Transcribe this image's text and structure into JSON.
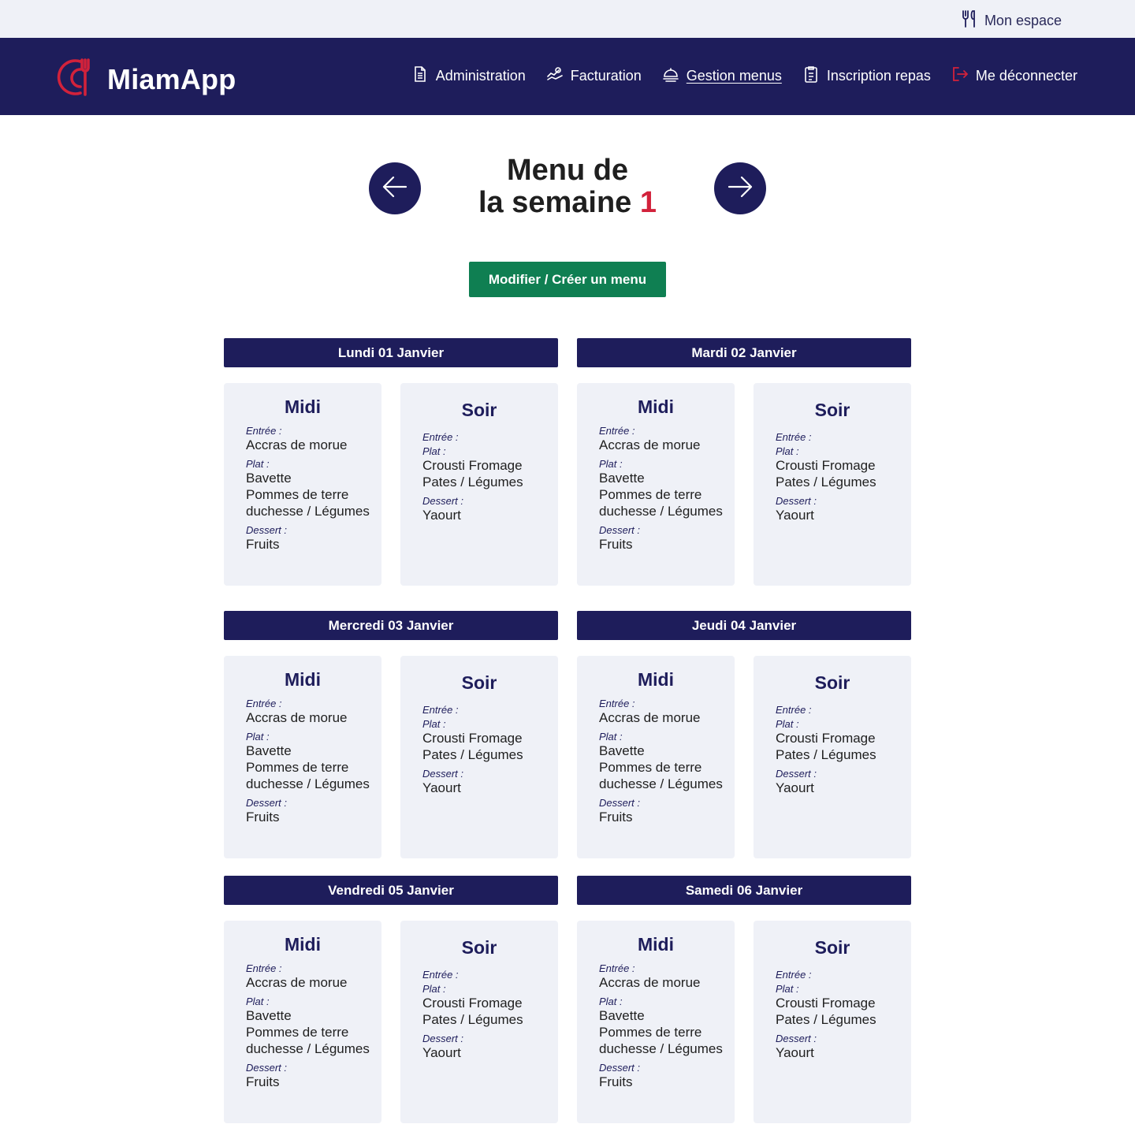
{
  "topbar": {
    "mon_espace": "Mon espace",
    "icon": "utensils-icon"
  },
  "brand": {
    "name": "MiamApp",
    "accent": "#d2223b",
    "navy": "#1e1d5b",
    "green": "#0f7f52"
  },
  "nav": [
    {
      "label": "Administration",
      "icon": "document-icon",
      "active": false
    },
    {
      "label": "Facturation",
      "icon": "payment-icon",
      "active": false
    },
    {
      "label": "Gestion menus",
      "icon": "cloche-icon",
      "active": true
    },
    {
      "label": "Inscription repas",
      "icon": "clipboard-icon",
      "active": false
    },
    {
      "label": "Me déconnecter",
      "icon": "logout-icon",
      "active": false
    }
  ],
  "week": {
    "title_line1": "Menu de",
    "title_line2": "la semaine",
    "number": "1"
  },
  "edit_button": "Modifier / Créer un menu",
  "labels": {
    "midi": "Midi",
    "soir": "Soir",
    "entree": "Entrée :",
    "plat": "Plat :",
    "dessert": "Dessert :"
  },
  "days": [
    {
      "name": "Lundi 01 Janvier",
      "midi": {
        "entree": "Accras de  morue",
        "plat": [
          "Bavette",
          "Pommes de terre",
          "duchesse / Légumes"
        ],
        "dessert": "Fruits"
      },
      "soir": {
        "plat": [
          "Crousti Fromage",
          "Pates / Légumes"
        ],
        "dessert": "Yaourt"
      }
    },
    {
      "name": "Mardi 02 Janvier",
      "midi": {
        "entree": "Accras de  morue",
        "plat": [
          "Bavette",
          "Pommes de terre",
          "duchesse / Légumes"
        ],
        "dessert": "Fruits"
      },
      "soir": {
        "plat": [
          "Crousti Fromage",
          "Pates / Légumes"
        ],
        "dessert": "Yaourt"
      }
    },
    {
      "name": "Mercredi 03 Janvier",
      "midi": {
        "entree": "Accras de  morue",
        "plat": [
          "Bavette",
          "Pommes de terre",
          "duchesse / Légumes"
        ],
        "dessert": "Fruits"
      },
      "soir": {
        "plat": [
          "Crousti Fromage",
          "Pates / Légumes"
        ],
        "dessert": "Yaourt"
      }
    },
    {
      "name": "Jeudi 04 Janvier",
      "midi": {
        "entree": "Accras de  morue",
        "plat": [
          "Bavette",
          "Pommes de terre",
          "duchesse / Légumes"
        ],
        "dessert": "Fruits"
      },
      "soir": {
        "plat": [
          "Crousti Fromage",
          "Pates / Légumes"
        ],
        "dessert": "Yaourt"
      }
    },
    {
      "name": "Vendredi 05 Janvier",
      "midi": {
        "entree": "Accras de  morue",
        "plat": [
          "Bavette",
          "Pommes de terre",
          "duchesse / Légumes"
        ],
        "dessert": "Fruits"
      },
      "soir": {
        "plat": [
          "Crousti Fromage",
          "Pates / Légumes"
        ],
        "dessert": "Yaourt"
      }
    },
    {
      "name": "Samedi 06 Janvier",
      "midi": {
        "entree": "Accras de  morue",
        "plat": [
          "Bavette",
          "Pommes de terre",
          "duchesse / Légumes"
        ],
        "dessert": "Fruits"
      },
      "soir": {
        "plat": [
          "Crousti Fromage",
          "Pates / Légumes"
        ],
        "dessert": "Yaourt"
      }
    }
  ]
}
